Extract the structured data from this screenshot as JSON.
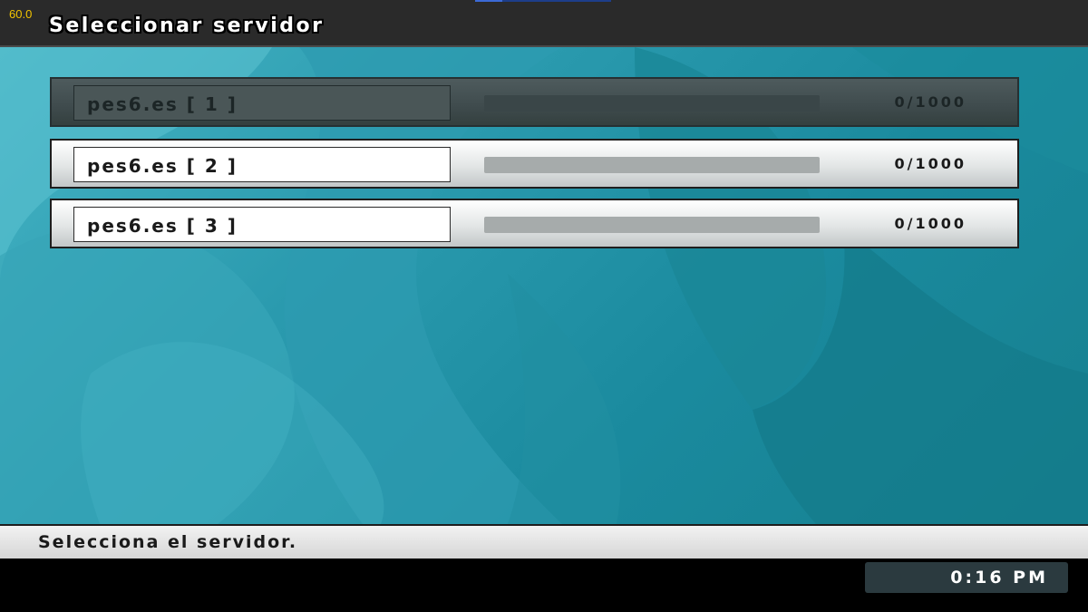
{
  "overlay": {
    "fps": "60.0"
  },
  "header": {
    "title": "Seleccionar servidor"
  },
  "servers": [
    {
      "name": "pes6.es [ 1 ]",
      "count": "0/1000",
      "load_fraction": 0,
      "state": "dim"
    },
    {
      "name": "pes6.es [ 2 ]",
      "count": "0/1000",
      "load_fraction": 0,
      "state": "normal"
    },
    {
      "name": "pes6.es [ 3 ]",
      "count": "0/1000",
      "load_fraction": 0,
      "state": "normal"
    }
  ],
  "status": {
    "hint": "Selecciona el servidor."
  },
  "footer": {
    "time": "0:16 PM"
  },
  "colors": {
    "background": "#1a8a9e",
    "title_bar": "#2a2a2a",
    "row_highlight": "#ffffff",
    "row_dim": "#3f4b4d"
  }
}
